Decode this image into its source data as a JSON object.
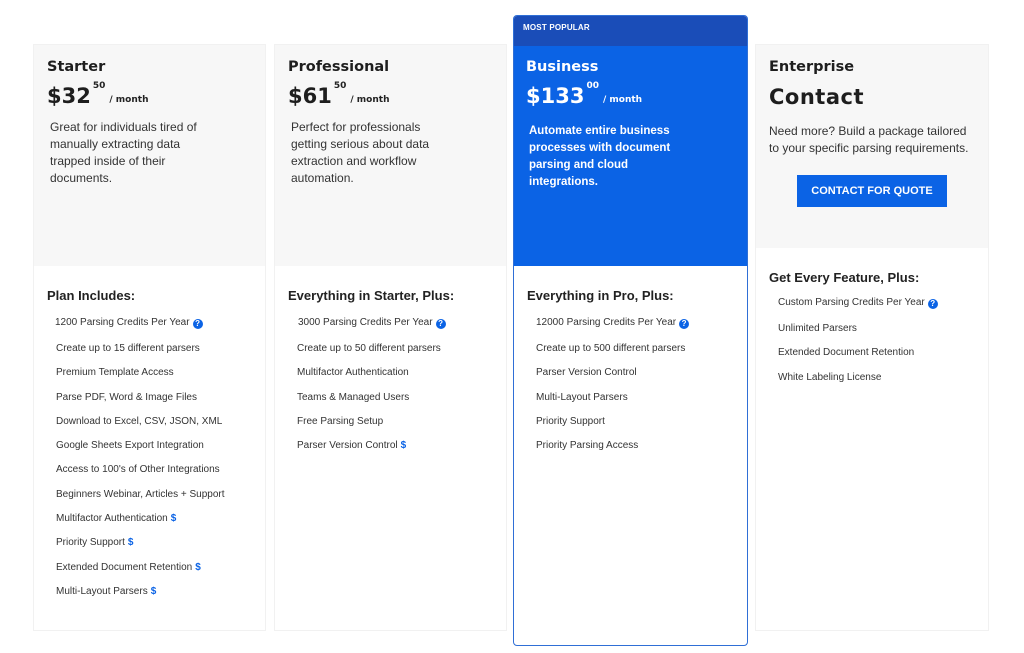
{
  "plans": [
    {
      "name": "Starter",
      "price": "$32",
      "cents": "50",
      "per": "/ month",
      "description": "Great for individuals tired of manually extracting data trapped inside of their documents.",
      "includes_title": "Plan Includes:",
      "features": [
        "1200 Parsing Credits Per Year",
        "Create up to 15 different parsers",
        "Premium Template Access",
        "Parse PDF, Word & Image Files",
        "Download to Excel, CSV, JSON, XML",
        "Google Sheets Export Integration",
        "Access to 100's of Other Integrations",
        "Beginners Webinar, Articles + Support",
        "Multifactor Authentication",
        "Priority Support",
        "Extended Document Retention",
        "Multi-Layout Parsers"
      ]
    },
    {
      "name": "Professional",
      "price": "$61",
      "cents": "50",
      "per": "/ month",
      "description": "Perfect for professionals getting serious about data extraction and workflow automation.",
      "includes_title": "Everything in Starter, Plus:",
      "features": [
        "3000 Parsing Credits Per Year",
        "Create up to 50 different parsers",
        "Multifactor Authentication",
        "Teams & Managed Users",
        "Free Parsing Setup",
        "Parser Version Control"
      ]
    },
    {
      "badge": "MOST POPULAR",
      "name": "Business",
      "price": "$133",
      "cents": "00",
      "per": "/ month",
      "description": "Automate entire business processes with document parsing and cloud integrations.",
      "includes_title": "Everything in Pro, Plus:",
      "features": [
        "12000 Parsing Credits Per Year",
        "Create up to 500 different parsers",
        "Parser Version Control",
        "Multi-Layout Parsers",
        "Priority Support",
        "Priority Parsing Access"
      ]
    },
    {
      "name": "Enterprise",
      "price_text": "Contact",
      "description": "Need more? Build a package tailored to your specific parsing requirements.",
      "button_label": "CONTACT FOR QUOTE",
      "includes_title": "Get Every Feature, Plus:",
      "features": [
        "Custom Parsing Credits Per Year",
        "Unlimited Parsers",
        "Extended Document Retention",
        "White Labeling License"
      ]
    }
  ],
  "paid_marker": "$",
  "help_icon_glyph": "?",
  "colors": {
    "accent": "#0b63e5",
    "banner": "#1a4db8",
    "panel": "#f7f7f7"
  }
}
